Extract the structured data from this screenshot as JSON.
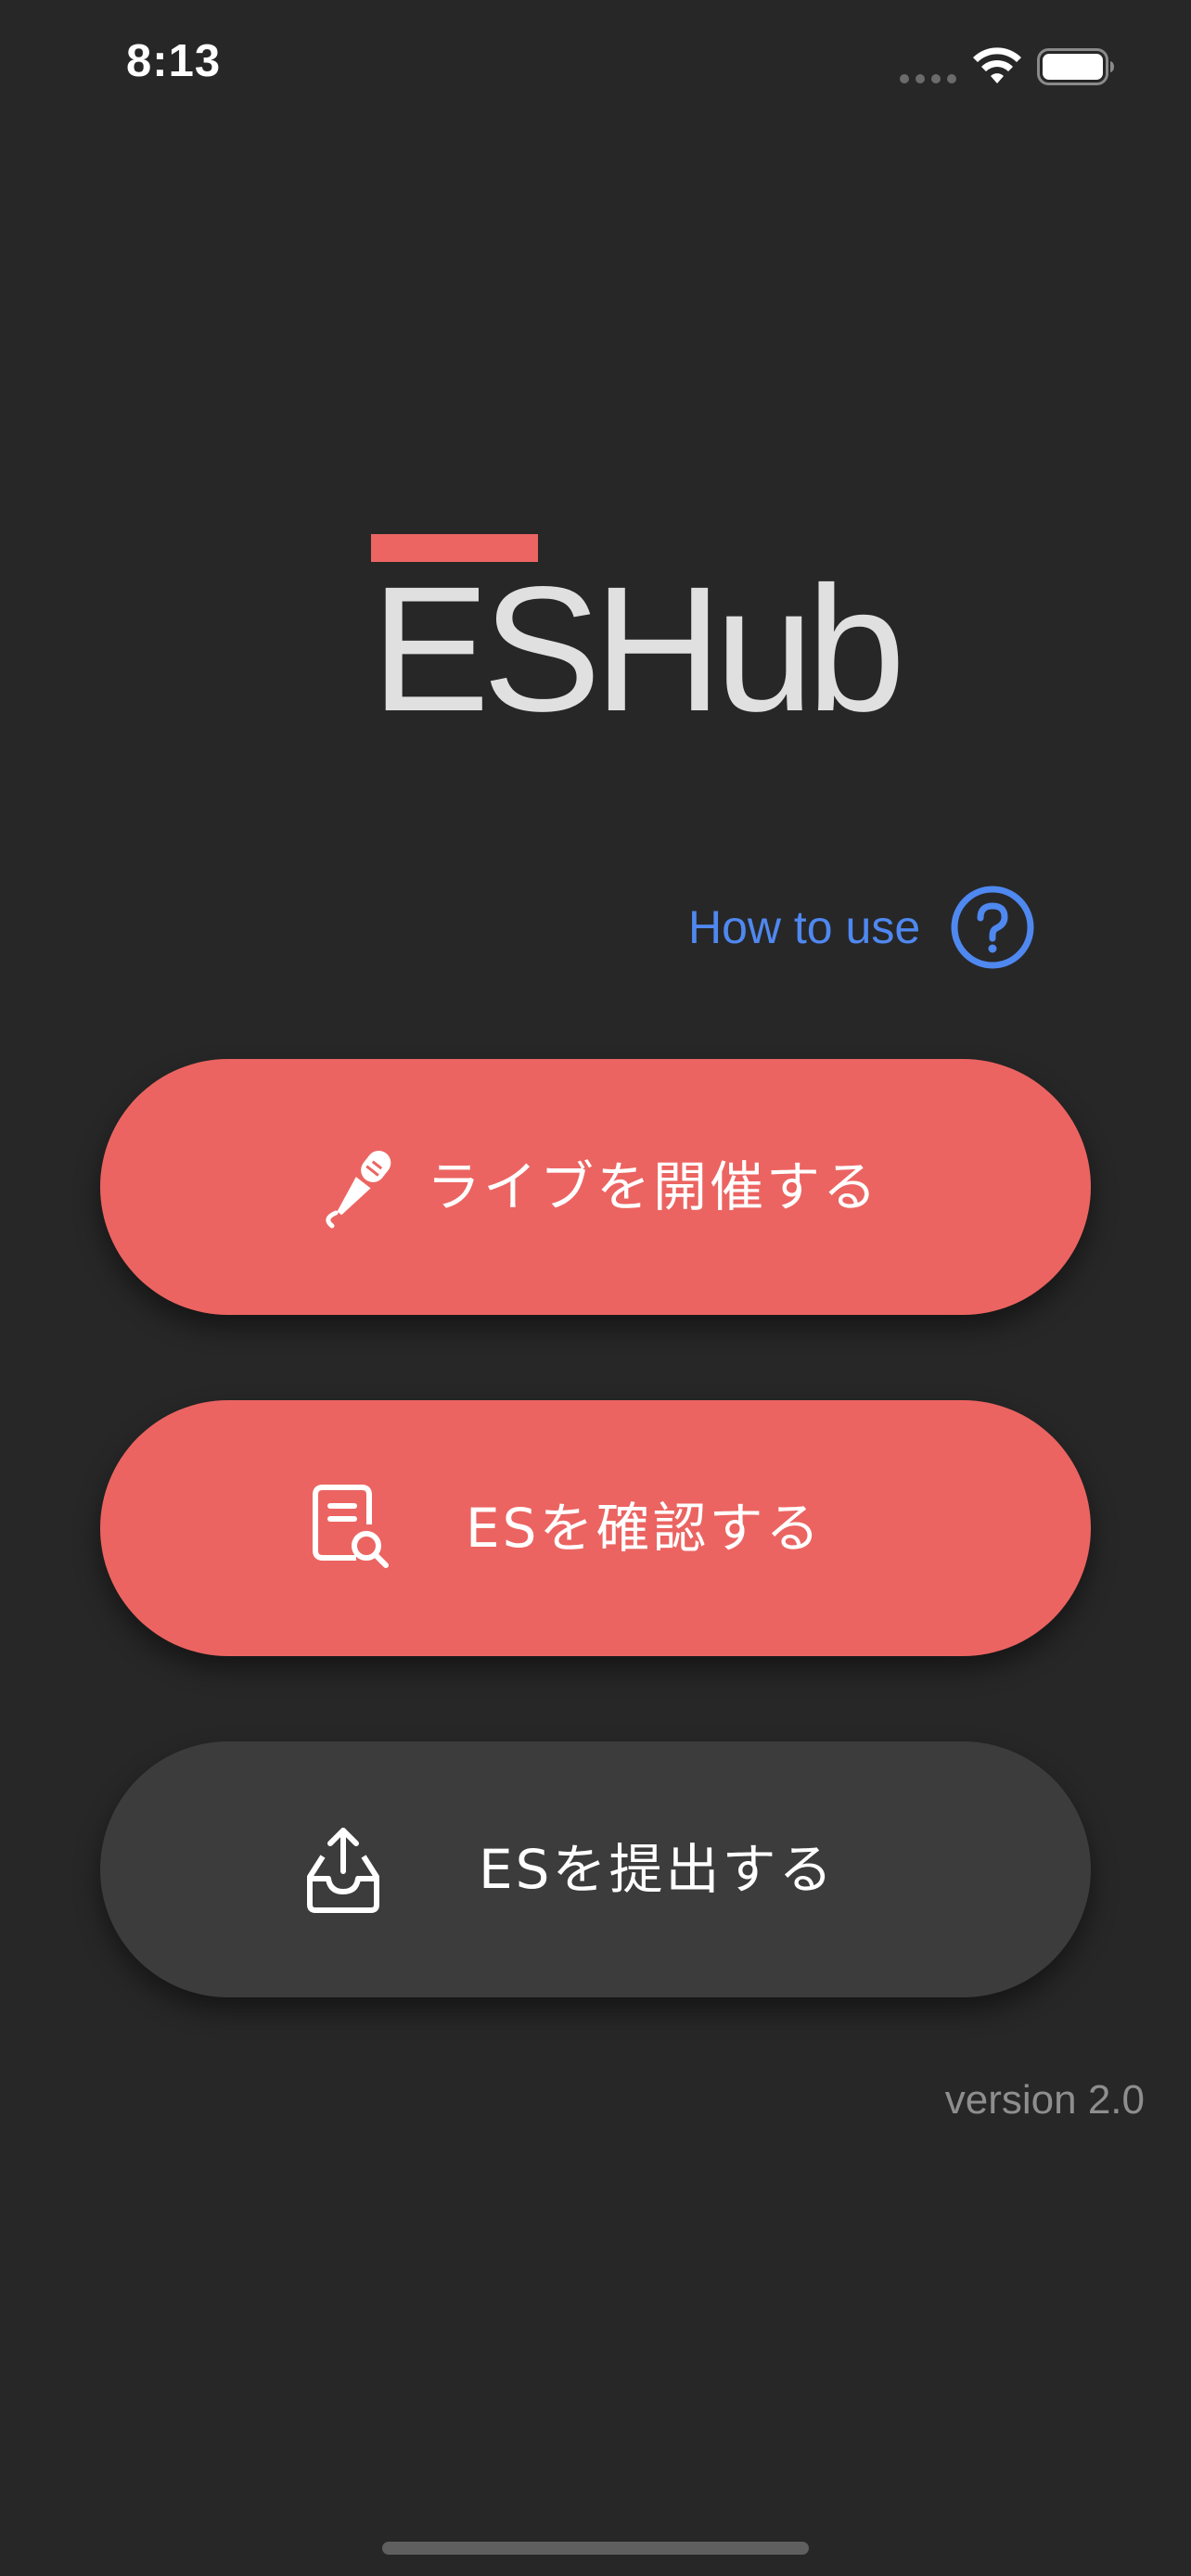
{
  "status_bar": {
    "time": "8:13"
  },
  "app": {
    "logo_text": "ESHub",
    "brand_color": "#ec6562"
  },
  "help": {
    "label": "How to use",
    "icon": "question-circle-icon",
    "color": "#4f88f0"
  },
  "actions": [
    {
      "label": "ライブを開催する",
      "icon": "microphone-icon",
      "style": "primary",
      "color": "#eb6461"
    },
    {
      "label": "ESを確認する",
      "icon": "document-search-icon",
      "style": "primary",
      "color": "#eb6461"
    },
    {
      "label": "ESを提出する",
      "icon": "inbox-upload-icon",
      "style": "secondary",
      "color": "#3c3c3c"
    }
  ],
  "footer": {
    "version": "version 2.0"
  }
}
